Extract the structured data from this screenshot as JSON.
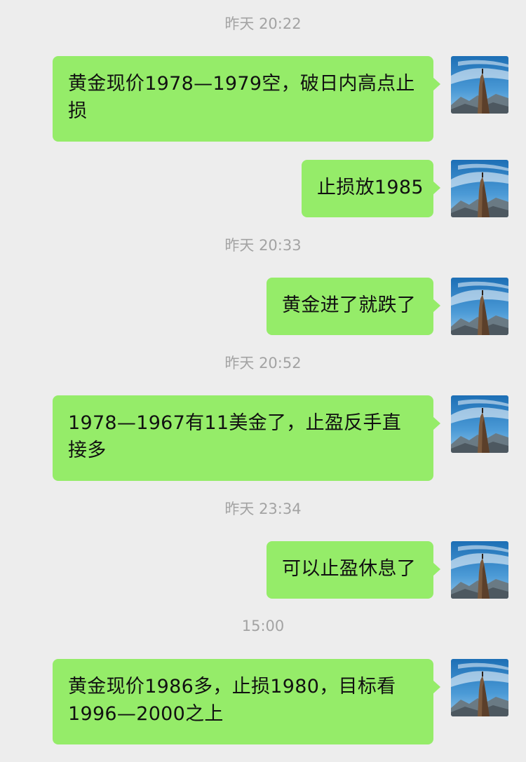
{
  "conversation": {
    "items": [
      {
        "kind": "time",
        "text": "昨天 20:22"
      },
      {
        "kind": "message",
        "text": "黄金现价1978—1979空，破日内高点止损",
        "avatar": "mountain-peak-avatar"
      },
      {
        "kind": "message",
        "text": "止损放1985",
        "avatar": "mountain-peak-avatar"
      },
      {
        "kind": "time",
        "text": "昨天 20:33"
      },
      {
        "kind": "message",
        "text": "黄金进了就跌了",
        "avatar": "mountain-peak-avatar"
      },
      {
        "kind": "time",
        "text": "昨天 20:52"
      },
      {
        "kind": "message",
        "text": "1978—1967有11美金了，止盈反手直接多",
        "avatar": "mountain-peak-avatar"
      },
      {
        "kind": "time",
        "text": "昨天 23:34"
      },
      {
        "kind": "message",
        "text": "可以止盈休息了",
        "avatar": "mountain-peak-avatar"
      },
      {
        "kind": "time",
        "text": "15:00"
      },
      {
        "kind": "message",
        "text": "黄金现价1986多，止损1980，目标看1996—2000之上",
        "avatar": "mountain-peak-avatar"
      }
    ]
  },
  "colors": {
    "background": "#ededed",
    "bubble": "#95ec69",
    "timestamp": "#a3a3a3"
  }
}
